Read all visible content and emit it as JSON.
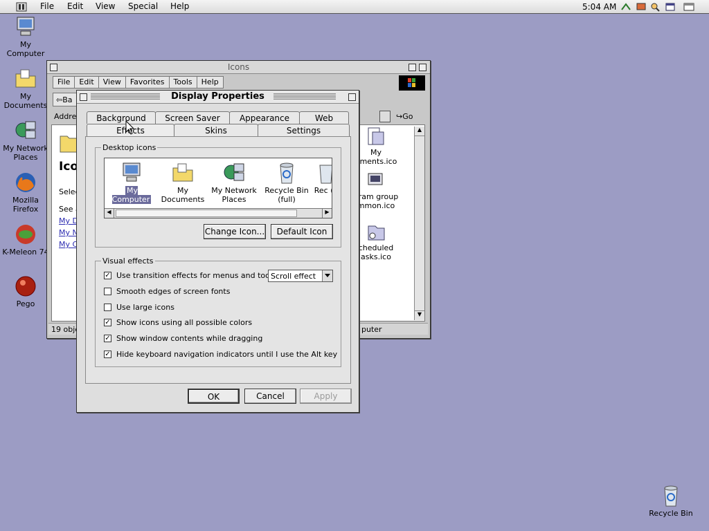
{
  "menubar": {
    "items": [
      {
        "label": "File",
        "key": "F"
      },
      {
        "label": "Edit",
        "key": "E"
      },
      {
        "label": "View",
        "key": "V"
      },
      {
        "label": "Special",
        "key": "S"
      },
      {
        "label": "Help",
        "key": "H"
      }
    ],
    "clock": "5:04 AM",
    "tray_icons": [
      "network-icon",
      "display-icon",
      "search-icon",
      "window-icon",
      "minimize-icon"
    ]
  },
  "desktop": {
    "icons": [
      {
        "label": "My Computer",
        "icon": "computer-icon"
      },
      {
        "label": "My Documents",
        "icon": "documents-folder-icon"
      },
      {
        "label": "My Network Places",
        "icon": "network-places-icon"
      },
      {
        "label": "Mozilla Firefox",
        "icon": "firefox-icon"
      },
      {
        "label": "K-Meleon 74",
        "icon": "k-meleon-icon"
      },
      {
        "label": "Pego",
        "icon": "pego-icon"
      },
      {
        "label": "Recycle Bin",
        "icon": "recycle-bin-icon"
      }
    ]
  },
  "explorer": {
    "title": "Icons",
    "menu": [
      "File",
      "Edit",
      "View",
      "Favorites",
      "Tools",
      "Help"
    ],
    "back_label": "Ba",
    "address_label": "Addres",
    "go_label": "Go",
    "folder_title": "Ico",
    "left_pane": [
      "Selec",
      "See a",
      "My D",
      "My N",
      "My C"
    ],
    "files": [
      "My\numents.ico",
      "gram group\nmmon.ico",
      "cheduled\nasks.ico"
    ],
    "status_count": "19 objec",
    "status_zone": "puter"
  },
  "dialog": {
    "title": "Display Properties",
    "tabs_back": [
      "Background",
      "Screen Saver",
      "Appearance",
      "Web"
    ],
    "tabs_front": [
      "Effects",
      "Skins",
      "Settings"
    ],
    "desktop_icons_legend": "Desktop icons",
    "icon_list": [
      {
        "label": "My Computer",
        "icon": "computer-icon",
        "selected": true
      },
      {
        "label": "My Documents",
        "icon": "documents-folder-icon",
        "selected": false
      },
      {
        "label": "My Network Places",
        "icon": "network-places-icon",
        "selected": false
      },
      {
        "label": "Recycle Bin (full)",
        "icon": "recycle-bin-full-icon",
        "selected": false
      },
      {
        "label": "Rec (e",
        "icon": "recycle-bin-empty-icon",
        "selected": false
      }
    ],
    "change_icon_label": "Change Icon...",
    "default_icon_label": "Default Icon",
    "visual_effects_legend": "Visual effects",
    "effects": [
      {
        "label": "Use transition effects for menus and tooltips",
        "checked": true
      },
      {
        "label": "Smooth edges of screen fonts",
        "checked": false
      },
      {
        "label": "Use large icons",
        "checked": false
      },
      {
        "label": "Show icons using all possible colors",
        "checked": true
      },
      {
        "label": "Show window contents while dragging",
        "checked": true
      },
      {
        "label": "Hide keyboard navigation indicators until I use the Alt key",
        "checked": true
      }
    ],
    "transition_select": "Scroll effect",
    "ok_label": "OK",
    "cancel_label": "Cancel",
    "apply_label": "Apply"
  }
}
